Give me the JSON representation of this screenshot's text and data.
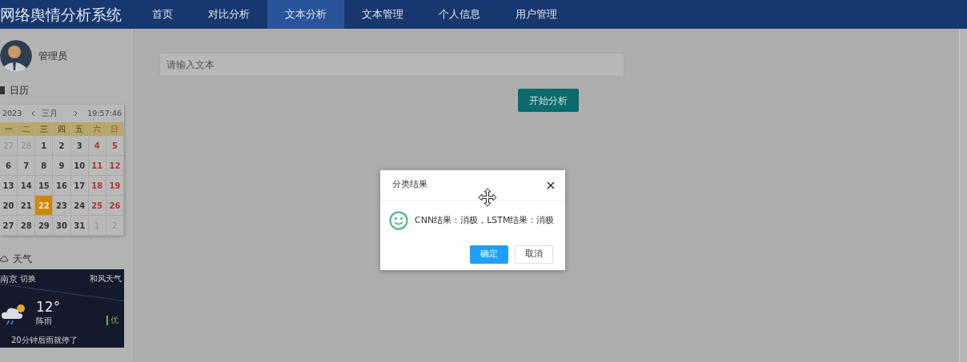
{
  "app": {
    "title": "网络舆情分析系统"
  },
  "nav": [
    {
      "label": "首页",
      "selected": false
    },
    {
      "label": "对比分析",
      "selected": false
    },
    {
      "label": "文本分析",
      "selected": true
    },
    {
      "label": "文本管理",
      "selected": false
    },
    {
      "label": "个人信息",
      "selected": false
    },
    {
      "label": "用户管理",
      "selected": false
    }
  ],
  "user": {
    "name": "管理员"
  },
  "calendar": {
    "heading": "日历",
    "year": "2023",
    "month": "三月",
    "time": "19:57:46",
    "weekdays": [
      {
        "label": "一",
        "weekend": false
      },
      {
        "label": "二",
        "weekend": false
      },
      {
        "label": "三",
        "weekend": false
      },
      {
        "label": "四",
        "weekend": false
      },
      {
        "label": "五",
        "weekend": false
      },
      {
        "label": "六",
        "weekend": true
      },
      {
        "label": "日",
        "weekend": true
      }
    ],
    "days": [
      {
        "label": "27",
        "kind": "other"
      },
      {
        "label": "28",
        "kind": "other"
      },
      {
        "label": "1",
        "kind": "weekday"
      },
      {
        "label": "2",
        "kind": "weekday"
      },
      {
        "label": "3",
        "kind": "weekday"
      },
      {
        "label": "4",
        "kind": "weekend"
      },
      {
        "label": "5",
        "kind": "weekend"
      },
      {
        "label": "6",
        "kind": "weekday"
      },
      {
        "label": "7",
        "kind": "weekday"
      },
      {
        "label": "8",
        "kind": "weekday"
      },
      {
        "label": "9",
        "kind": "weekday"
      },
      {
        "label": "10",
        "kind": "weekday"
      },
      {
        "label": "11",
        "kind": "weekend"
      },
      {
        "label": "12",
        "kind": "weekend"
      },
      {
        "label": "13",
        "kind": "weekday"
      },
      {
        "label": "14",
        "kind": "weekday"
      },
      {
        "label": "15",
        "kind": "weekday"
      },
      {
        "label": "16",
        "kind": "weekday"
      },
      {
        "label": "17",
        "kind": "weekday"
      },
      {
        "label": "18",
        "kind": "weekend"
      },
      {
        "label": "19",
        "kind": "weekend"
      },
      {
        "label": "20",
        "kind": "weekday"
      },
      {
        "label": "21",
        "kind": "weekday"
      },
      {
        "label": "22",
        "kind": "today"
      },
      {
        "label": "23",
        "kind": "weekday"
      },
      {
        "label": "24",
        "kind": "weekday"
      },
      {
        "label": "25",
        "kind": "weekend"
      },
      {
        "label": "26",
        "kind": "weekend"
      },
      {
        "label": "27",
        "kind": "weekday"
      },
      {
        "label": "28",
        "kind": "weekday"
      },
      {
        "label": "29",
        "kind": "weekday"
      },
      {
        "label": "30",
        "kind": "weekday"
      },
      {
        "label": "31",
        "kind": "weekday"
      },
      {
        "label": "1",
        "kind": "other"
      },
      {
        "label": "2",
        "kind": "other"
      }
    ]
  },
  "weather": {
    "heading": "天气",
    "city": "南京",
    "switch": "切换",
    "provider": "和风天气",
    "temperature": "12°",
    "condition": "阵雨",
    "air_quality": "优",
    "forecast": "20分钟后雨就停了"
  },
  "analysis": {
    "placeholder": "请输入文本",
    "button": "开始分析"
  },
  "dialog": {
    "title": "分类结果",
    "message": "CNN结果：消极，LSTM结果：消极",
    "buttons": [
      {
        "label": "确定",
        "kind": "primary"
      },
      {
        "label": "取消",
        "kind": "secondary"
      }
    ]
  }
}
